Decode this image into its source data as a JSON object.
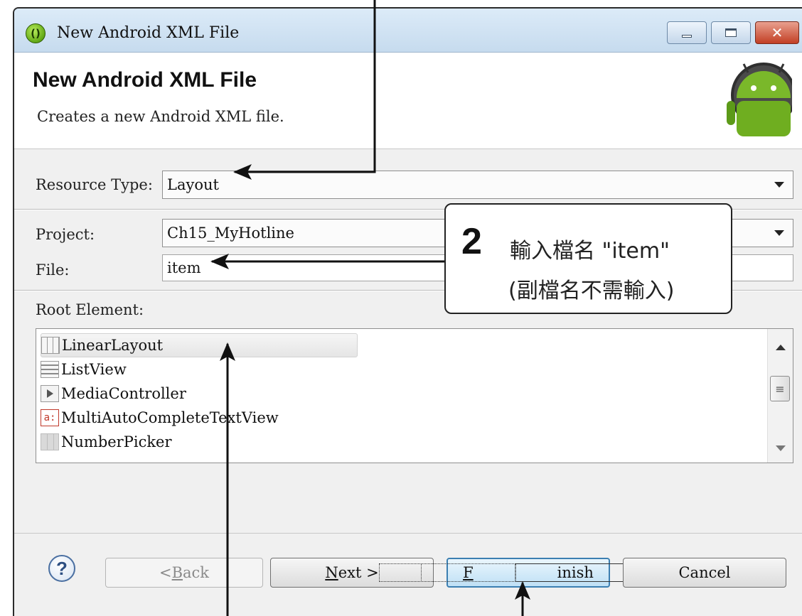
{
  "window": {
    "title": "New Android XML File",
    "icon": "android-adt-icon",
    "controls": {
      "minimize": "minimize-icon",
      "maximize": "maximize-icon",
      "close": "close-icon"
    }
  },
  "header": {
    "title": "New Android XML File",
    "description": "Creates a new Android XML file.",
    "logo": "android-logo"
  },
  "form": {
    "resource_type": {
      "label": "Resource Type:",
      "value": "Layout"
    },
    "project": {
      "label": "Project:",
      "value": "Ch15_MyHotline"
    },
    "file": {
      "label": "File:",
      "value": "item"
    },
    "root_element": {
      "label": "Root Element:"
    }
  },
  "root_elements": [
    {
      "label": "LinearLayout",
      "icon": "linear-layout-icon",
      "selected": true
    },
    {
      "label": "ListView",
      "icon": "list-view-icon",
      "selected": false
    },
    {
      "label": "MediaController",
      "icon": "media-controller-icon",
      "selected": false
    },
    {
      "label": "MultiAutoCompleteTextView",
      "icon": "autocomplete-text-icon",
      "selected": false
    },
    {
      "label": "NumberPicker",
      "icon": "number-picker-icon",
      "selected": false
    }
  ],
  "footer": {
    "help": "?",
    "back": {
      "prefix": "< ",
      "mnemonic": "B",
      "rest": "ack",
      "enabled": false
    },
    "next": {
      "mnemonic": "N",
      "rest": "ext >"
    },
    "finish": {
      "mnemonic": "F",
      "rest": "inish"
    },
    "cancel": "Cancel"
  },
  "annotation": {
    "step": "2",
    "line1": "輸入檔名 \"item\"",
    "line2": "(副檔名不需輸入)"
  },
  "colors": {
    "titlebar": "#c6dbee",
    "android_green": "#62a816",
    "default_button": "#3c7fb1",
    "close_button": "#c23f24"
  }
}
